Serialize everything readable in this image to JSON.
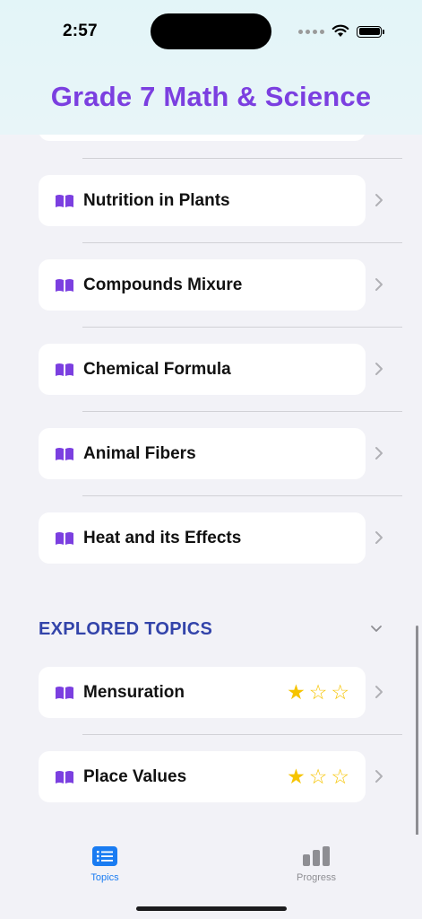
{
  "status_bar": {
    "time": "2:57"
  },
  "app": {
    "title": "Grade 7 Math & Science"
  },
  "topics": [
    {
      "label": "Nutrition in Plants"
    },
    {
      "label": "Compounds Mixure"
    },
    {
      "label": "Chemical Formula"
    },
    {
      "label": "Animal Fibers"
    },
    {
      "label": "Heat and its Effects"
    }
  ],
  "explored": {
    "title": "EXPLORED TOPICS",
    "items": [
      {
        "label": "Mensuration",
        "stars_filled": 1,
        "stars_total": 3
      },
      {
        "label": "Place Values",
        "stars_filled": 1,
        "stars_total": 3
      }
    ]
  },
  "tabbar": {
    "topics_label": "Topics",
    "progress_label": "Progress",
    "selected": "Topics"
  },
  "colors": {
    "accent_purple": "#7b3fe0",
    "section_blue": "#3344aa",
    "tab_active": "#1a7cf2",
    "star": "#f6c400"
  },
  "icons": [
    "book-icon",
    "chevron-right-icon",
    "chevron-down-icon",
    "star-icon",
    "list-icon",
    "bar-chart-icon",
    "wifi-icon",
    "battery-icon"
  ]
}
